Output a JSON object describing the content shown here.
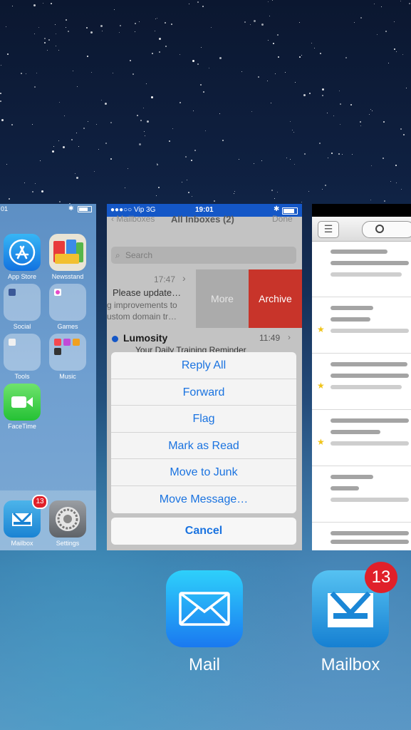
{
  "colors": {
    "mail_blue": "#1457c7",
    "archive_red": "#c8342a",
    "action_blue": "#1a73e0",
    "badge_red": "#e0202a"
  },
  "home_card": {
    "status_time": "01",
    "apps": [
      {
        "label": "App Store",
        "icon": "app-store-icon"
      },
      {
        "label": "Newsstand",
        "icon": "newsstand-icon"
      },
      {
        "label": "Social",
        "icon": "folder-icon"
      },
      {
        "label": "Games",
        "icon": "folder-icon"
      },
      {
        "label": "Tools",
        "icon": "folder-icon"
      },
      {
        "label": "Music",
        "icon": "folder-icon"
      },
      {
        "label": "FaceTime",
        "icon": "facetime-icon"
      }
    ],
    "dock": [
      {
        "label": "Mailbox",
        "badge": "13"
      },
      {
        "label": "Settings"
      }
    ]
  },
  "mail_card": {
    "status": {
      "carrier": "●●●○○ Vip   3G",
      "time": "19:01"
    },
    "nav": {
      "back": "‹ Mailboxes",
      "title": "All Inboxes (2)",
      "done": "Done"
    },
    "search_placeholder": "Search",
    "message1": {
      "time": "17:47",
      "chevron": "›",
      "line1": "Please update…",
      "line2": "g improvements to",
      "line3": "ustom domain tr…"
    },
    "swipe_more": "More",
    "swipe_archive": "Archive",
    "message2": {
      "from": "Lumosity",
      "time": "11:49",
      "subject": "Your Daily Training Reminder"
    },
    "actions": [
      "Reply All",
      "Forward",
      "Flag",
      "Mark as Read",
      "Move to Junk",
      "Move Message…"
    ],
    "cancel": "Cancel"
  },
  "dock_apps": [
    {
      "label": "Mail",
      "icon": "mail-envelope-icon"
    },
    {
      "label": "Mailbox",
      "icon": "mailbox-tray-icon",
      "badge": "13"
    }
  ]
}
